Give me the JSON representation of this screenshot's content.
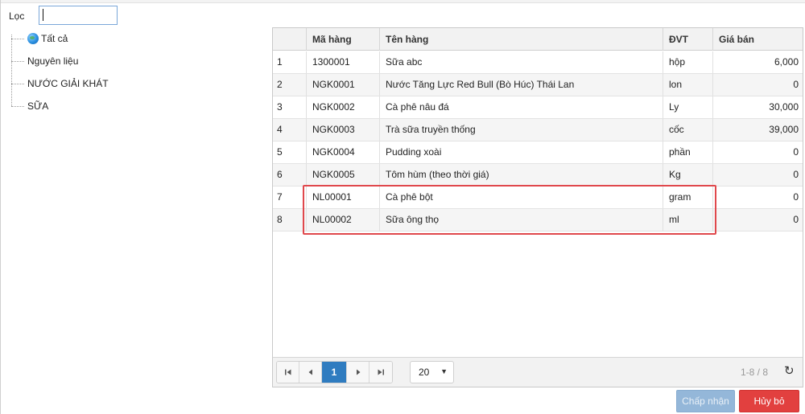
{
  "filter": {
    "label": "Lọc",
    "value": ""
  },
  "tree": {
    "items": [
      {
        "label": "Tất cả",
        "icon": "globe-icon"
      },
      {
        "label": "Nguyên liệu"
      },
      {
        "label": "NƯỚC GIẢI KHÁT"
      },
      {
        "label": "SỮA"
      }
    ]
  },
  "table": {
    "columns": [
      "",
      "Mã hàng",
      "Tên hàng",
      "ĐVT",
      "Giá bán"
    ],
    "rows": [
      [
        "1",
        "1300001",
        "Sữa abc",
        "hộp",
        "6,000"
      ],
      [
        "2",
        "NGK0001",
        "Nước Tăng Lực Red Bull (Bò Húc) Thái Lan",
        "lon",
        "0"
      ],
      [
        "3",
        "NGK0002",
        "Cà phê nâu đá",
        "Ly",
        "30,000"
      ],
      [
        "4",
        "NGK0003",
        "Trà sữa truyền thống",
        "cốc",
        "39,000"
      ],
      [
        "5",
        "NGK0004",
        "Pudding xoài",
        "phần",
        "0"
      ],
      [
        "6",
        "NGK0005",
        "Tôm hùm (theo thời giá)",
        "Kg",
        "0"
      ],
      [
        "7",
        "NL00001",
        "Cà phê bột",
        "gram",
        "0"
      ],
      [
        "8",
        "NL00002",
        "Sữa ông thọ",
        "ml",
        "0"
      ]
    ]
  },
  "pager": {
    "current_page": "1",
    "page_size": "20",
    "info": "1-8 / 8",
    "icons": [
      "first-page-icon",
      "prev-page-icon",
      "next-page-icon",
      "last-page-icon",
      "refresh-icon"
    ]
  },
  "buttons": {
    "accept": "Chấp nhận",
    "cancel": "Hủy bỏ"
  },
  "colors": {
    "highlight": "#e0484c",
    "accent": "#2f7cc0",
    "cancel": "#e2403f",
    "accept_disabled": "#94b7d9"
  }
}
